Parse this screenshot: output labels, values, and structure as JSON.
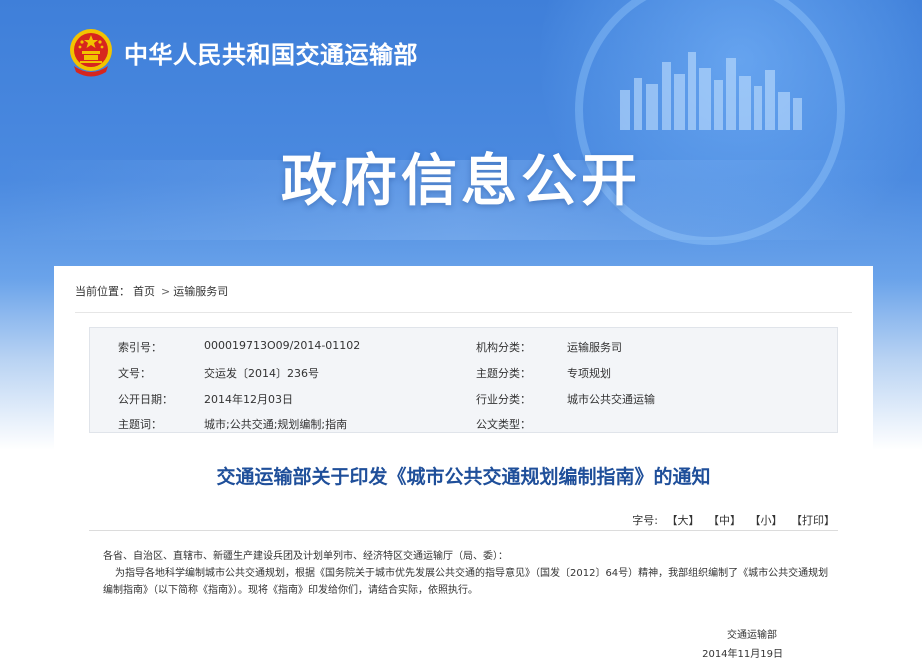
{
  "header": {
    "ministry_name": "中华人民共和国交通运输部",
    "banner_title": "政府信息公开"
  },
  "breadcrumb": {
    "prefix": "当前位置：",
    "items": [
      "首页",
      "运输服务司"
    ],
    "separator": ">"
  },
  "meta": {
    "index_no_label": "索引号：",
    "index_no_value": "000019713O09/2014-01102",
    "org_label": "机构分类：",
    "org_value": "运输服务司",
    "doc_no_label": "文号：",
    "doc_no_value": "交运发〔2014〕236号",
    "topic_label": "主题分类：",
    "topic_value": "专项规划",
    "date_label": "公开日期：",
    "date_value": "2014年12月03日",
    "industry_label": "行业分类：",
    "industry_value": "城市公共交通运输",
    "keywords_label": "主题词：",
    "keywords_value": "城市;公共交通;规划编制;指南",
    "doctype_label": "公文类型：",
    "doctype_value": ""
  },
  "document": {
    "title": "交通运输部关于印发《城市公共交通规划编制指南》的通知",
    "fontsize_label": "字号:",
    "fontsize_large": "【大】",
    "fontsize_medium": "【中】",
    "fontsize_small": "【小】",
    "print": "【打印】",
    "addressee": "各省、自治区、直辖市、新疆生产建设兵团及计划单列市、经济特区交通运输厅（局、委）：",
    "body_line1": "为指导各地科学编制城市公共交通规划，根据《国务院关于城市优先发展公共交通的指导意见》（国发〔2012〕64号）精神，我部组织编制了《城市公共交通规划",
    "body_line2": "编制指南》（以下简称《指南》）。现将《指南》印发给你们，请结合实际，依照执行。",
    "signoff_org": "交通运输部",
    "signoff_date": "2014年11月19日"
  },
  "colors": {
    "banner_blue": "#3f7fd9",
    "title_blue": "#1f4f9a",
    "meta_bg": "#f3f5f8"
  }
}
